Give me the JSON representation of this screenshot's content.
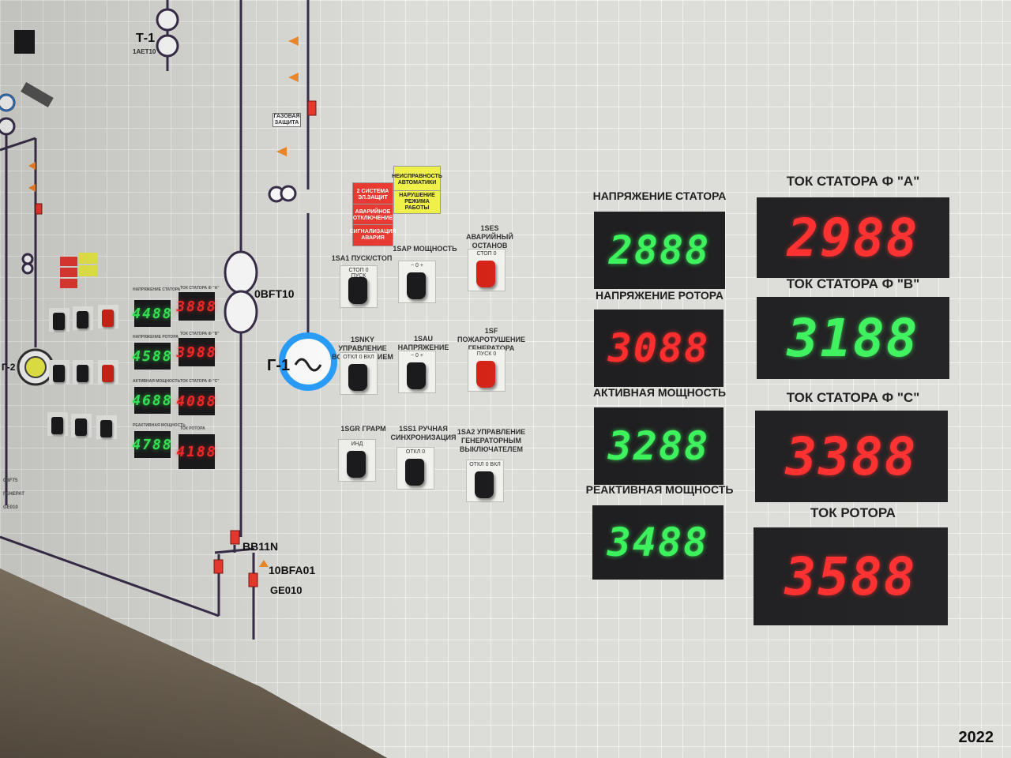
{
  "colors": {
    "wall": "#dcdcd8",
    "green_led": "#39f25a",
    "red_led": "#ff2a2a",
    "alarm_red": "#ea3b32",
    "alarm_yellow": "#f0f04a",
    "generator_ring": "#2aa0ff"
  },
  "mimic": {
    "transformer_label": "Т-1",
    "transformer_code": "1AET10",
    "main_transformer_code": "0BFT10",
    "generator_label": "Г-1",
    "left_generator_label": "Г-2",
    "busbar_code": "BB11N",
    "breaker_code": "10BFA01",
    "ge_code": "GE010",
    "protection_label": "ГАЗОВАЯ ЗАЩИТА",
    "left_codes": [
      "0BFT5",
      "ГЕНЕРАТ",
      "GE010"
    ]
  },
  "alarms": [
    {
      "text": "2 СИСТЕМА ЭЛ.ЗАЩИТ",
      "color": "red"
    },
    {
      "text": "НЕИСПРАВНОСТЬ АВТОМАТИКИ",
      "color": "yellow"
    },
    {
      "text": "АВАРИЙНОЕ ОТКЛЮЧЕНИЕ",
      "color": "red"
    },
    {
      "text": "НАРУШЕНИЕ РЕЖИМА РАБОТЫ",
      "color": "yellow"
    },
    {
      "text": "СИГНАЛИЗАЦИЯ АВАРИЯ",
      "color": "red"
    }
  ],
  "switches": [
    {
      "label": "1SA1 ПУСК/СТОП",
      "scale": "СТОП 0 ПУСК",
      "knob": "black"
    },
    {
      "label": "1SAP МОЩНОСТЬ",
      "scale": "− 0 +",
      "knob": "black"
    },
    {
      "label": "1SES АВАРИЙНЫЙ ОСТАНОВ",
      "scale": "СТОП 0",
      "knob": "red"
    },
    {
      "label": "1SNKY УПРАВЛЕНИЕ ВОЗБУЖДЕНИЕМ",
      "scale": "ОТКЛ 0 ВКЛ",
      "knob": "black"
    },
    {
      "label": "1SAU НАПРЯЖЕНИЕ",
      "scale": "− 0 +",
      "knob": "black"
    },
    {
      "label": "1SF ПОЖАРОТУШЕНИЕ ГЕНЕРАТОРА",
      "scale": "ПУСК 0",
      "knob": "red"
    },
    {
      "label": "1SGR ГРАРМ",
      "scale": "ИНД",
      "knob": "black"
    },
    {
      "label": "1SS1 РУЧНАЯ СИНХРОНИЗАЦИЯ",
      "scale": "ОТКЛ 0",
      "knob": "black"
    },
    {
      "label": "1SA2 УПРАВЛЕНИЕ ГЕНЕРАТОРНЫМ ВЫКЛЮЧАТЕЛЕМ",
      "scale": "ОТКЛ 0 ВКЛ",
      "knob": "black"
    }
  ],
  "displays_left": [
    {
      "title": "НАПРЯЖЕНИЕ СТАТОРА",
      "value": "2888",
      "color": "green"
    },
    {
      "title": "НАПРЯЖЕНИЕ РОТОРА",
      "value": "3088",
      "color": "red"
    },
    {
      "title": "АКТИВНАЯ МОЩНОСТЬ",
      "value": "3288",
      "color": "green"
    },
    {
      "title": "РЕАКТИВНАЯ МОЩНОСТЬ",
      "value": "3488",
      "color": "green"
    }
  ],
  "displays_right": [
    {
      "title": "ТОК СТАТОРА Ф \"А\"",
      "value": "2988",
      "color": "red"
    },
    {
      "title": "ТОК СТАТОРА Ф \"В\"",
      "value": "3188",
      "color": "green"
    },
    {
      "title": "ТОК СТАТОРА Ф \"С\"",
      "value": "3388",
      "color": "red"
    },
    {
      "title": "ТОК РОТОРА",
      "value": "3588",
      "color": "red"
    }
  ],
  "small_panel": {
    "green_values": [
      "4488",
      "4588",
      "4688",
      "4788"
    ],
    "red_values": [
      "3888",
      "3988",
      "4088",
      "4188"
    ],
    "titles_left": [
      "НАПРЯЖЕНИЕ СТАТОРА",
      "НАПРЯЖЕНИЕ РОТОРА",
      "АКТИВНАЯ МОЩНОСТЬ",
      "РЕАКТИВНАЯ МОЩНОСТЬ"
    ],
    "titles_right": [
      "ТОК СТАТОРА Ф \"А\"",
      "ТОК СТАТОРА Ф \"В\"",
      "ТОК СТАТОРА Ф \"С\"",
      "ТОК РОТОРА"
    ]
  },
  "year": "2022"
}
